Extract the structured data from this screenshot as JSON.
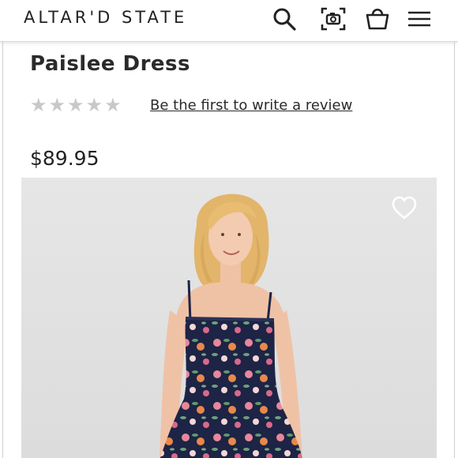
{
  "header": {
    "logo": "ALTAR'D STATE",
    "icons": [
      "search-icon",
      "camera-search-icon",
      "shopping-bag-icon",
      "hamburger-menu-icon"
    ]
  },
  "product": {
    "name": "Paislee Dress",
    "rating": 0,
    "rating_max": 5,
    "review_link": "Be the first to write a review",
    "price": "$89.95"
  },
  "image": {
    "wishlist_icon": "heart-outline-icon",
    "background_color": "#e0e0e0"
  }
}
